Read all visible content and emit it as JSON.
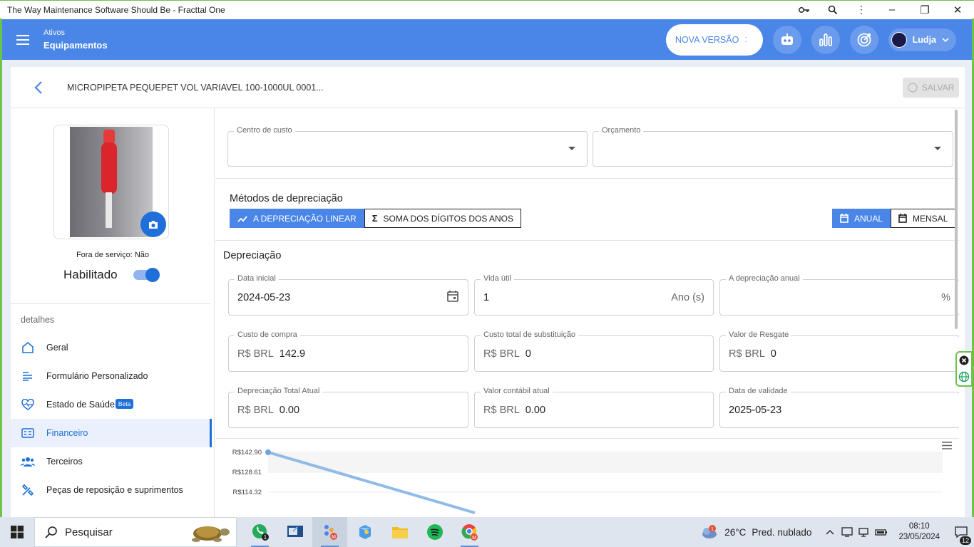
{
  "window": {
    "title": "The Way Maintenance Software Should Be - Fracttal One",
    "tools": [
      "key-icon",
      "zoom-icon",
      "more-vert-icon"
    ],
    "controls": [
      "minimize-icon",
      "restore-icon",
      "close-icon"
    ]
  },
  "appbar": {
    "breadcrumb_top": "Ativos",
    "breadcrumb_main": "Equipamentos",
    "nova_versao": "NOVA VERSÃO",
    "user_name": "Ludja"
  },
  "asset": {
    "title": "MICROPIPETA PEQUEPET VOL VARIAVEL 100-1000UL 0001...",
    "save_label": "SALVAR",
    "status": "Fora de serviço: Não",
    "enabled_label": "Habilitado",
    "enabled": true
  },
  "sidebar": {
    "section": "detalhes",
    "items": [
      {
        "label": "Geral",
        "icon": "home-icon",
        "active": false
      },
      {
        "label": "Formulário Personalizado",
        "icon": "form-lines-icon",
        "active": false
      },
      {
        "label": "Estado de Saúde",
        "icon": "heart-pulse-icon",
        "active": false,
        "badge": "Beta"
      },
      {
        "label": "Financeiro",
        "icon": "money-icon",
        "active": true
      },
      {
        "label": "Terceiros",
        "icon": "people-icon",
        "active": false
      },
      {
        "label": "Peças de reposição e suprimentos",
        "icon": "tools-icon",
        "active": false
      }
    ]
  },
  "financeiro": {
    "centro_custo": {
      "label": "Centro de custo",
      "value": ""
    },
    "orcamento": {
      "label": "Orçamento",
      "value": ""
    },
    "metodos_title": "Métodos de depreciação",
    "method_linear": "A DEPRECIAÇÃO LINEAR",
    "method_soma": "SOMA DOS DÍGITOS DOS ANOS",
    "period_anual": "ANUAL",
    "period_mensal": "MENSAL",
    "section_title": "Depreciação",
    "currency_prefix": "R$ BRL",
    "data_inicial": {
      "label": "Data inicial",
      "value": "2024-05-23"
    },
    "vida_util": {
      "label": "Vida útil",
      "value": "1",
      "suffix": "Ano (s)"
    },
    "depreciacao_anual": {
      "label": "A depreciação anual",
      "value": "",
      "suffix": "%"
    },
    "custo_compra": {
      "label": "Custo de compra",
      "value": "142.9"
    },
    "custo_substituicao": {
      "label": "Custo total de substituição",
      "value": "0"
    },
    "valor_resgate": {
      "label": "Valor de Resgate",
      "value": "0"
    },
    "depreciacao_total": {
      "label": "Depreciação Total Atual",
      "value": "0.00"
    },
    "valor_contabil": {
      "label": "Valor contábil atual",
      "value": "0.00"
    },
    "data_validade": {
      "label": "Data de validade",
      "value": "2025-05-23"
    }
  },
  "chart_data": {
    "type": "line",
    "y_tick_labels": [
      "R$142.90",
      "R$128.61",
      "R$114.32"
    ],
    "y_ticks": [
      142.9,
      128.61,
      114.32
    ],
    "series": [
      {
        "values": [
          142.9
        ]
      }
    ],
    "color": "#8fbbe6"
  },
  "taskbar": {
    "search_placeholder": "Pesquisar",
    "whatsapp_badge": "1",
    "weather_temp": "26°C",
    "weather_text": "Pred. nublado",
    "weather_badge": "1",
    "time": "08:10",
    "date": "23/05/2024",
    "notification_count": "12"
  }
}
